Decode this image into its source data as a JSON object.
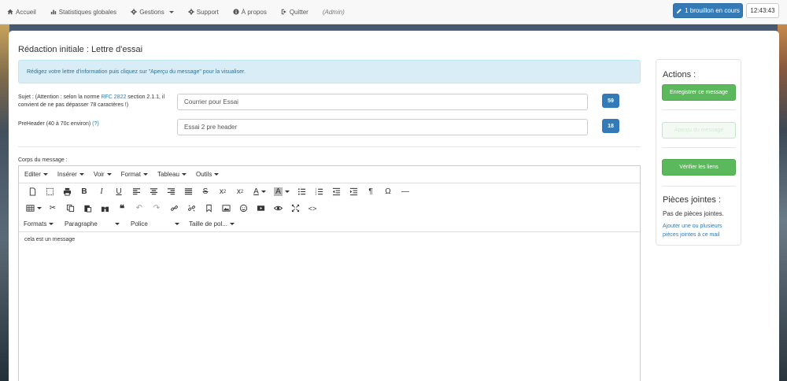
{
  "nav": {
    "items": [
      {
        "label": "Accueil",
        "icon": "home-icon"
      },
      {
        "label": "Statistiques globales",
        "icon": "bar-chart-icon"
      },
      {
        "label": "Gestions",
        "icon": "gear-icon"
      },
      {
        "label": "Support",
        "icon": "gear-icon"
      },
      {
        "label": "À propos",
        "icon": "info-icon"
      },
      {
        "label": "Quitter",
        "icon": "logout-icon"
      }
    ],
    "admin": "(Admin)",
    "drafts_label": "1 brouillon en cours",
    "clock": "12:43:43"
  },
  "page": {
    "title": "Rédaction initiale : Lettre d'essai",
    "info": "Rédigez votre lettre d'information puis cliquez sur \"Aperçu du message\" pour la visualiser."
  },
  "form": {
    "subject_label_a": "Sujet : (Attention : selon la norme ",
    "subject_label_link": "RFC 2822",
    "subject_label_b": " section 2.1.1, il convient de ne pas dépasser 78 caractères !)",
    "subject_value": "Courrier pour Essai",
    "subject_count": "59",
    "preheader_label": "PreHeader (40 à 70c environ) ",
    "preheader_help": "(?)",
    "preheader_value": "Essai 2 pre header",
    "preheader_count": "18",
    "body_label": "Corps du message :"
  },
  "editor": {
    "menus": [
      "Editer",
      "Insérer",
      "Voir",
      "Format",
      "Tableau",
      "Outils"
    ],
    "formats": {
      "formats": "Formats",
      "paragraph": "Paragraphe",
      "font": "Police",
      "size": "Taille de pol..."
    },
    "content": "cela est un message"
  },
  "sidebar": {
    "actions_title": "Actions :",
    "save": "Enregistrer ce message",
    "preview": "Aperçu du message",
    "check_links": "Vérifier les liens",
    "attachments_title": "Pièces jointes :",
    "no_attachments": "Pas de pièces jointes.",
    "add_attachments": "Ajouter une ou plusieurs pièces jointes à ce mail"
  }
}
